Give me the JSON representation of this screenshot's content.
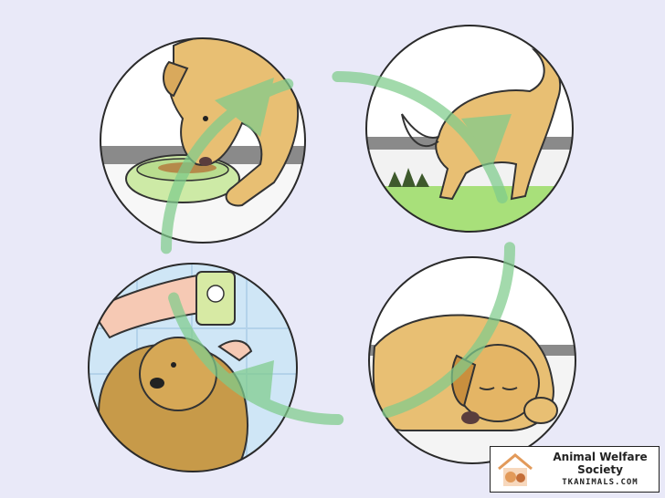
{
  "illustration": {
    "panels": [
      {
        "scene": "dog-eating-from-bowl"
      },
      {
        "scene": "dog-relieving-on-grass"
      },
      {
        "scene": "dog-being-bathed"
      },
      {
        "scene": "dog-sleeping"
      }
    ],
    "cycle_color": "#7fcc8c"
  },
  "watermark": {
    "title": "Animal Welfare Society",
    "url": "TKANIMALS.COM",
    "icon": "house-pets-icon"
  }
}
